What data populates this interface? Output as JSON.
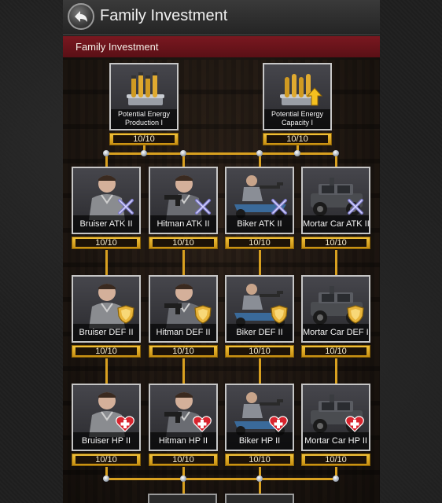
{
  "header": {
    "title": "Family Investment"
  },
  "subbar": {
    "title": "Family Investment"
  },
  "top_items": [
    {
      "label_line1": "Potential Energy",
      "label_line2": "Production I",
      "progress": "10/10"
    },
    {
      "label_line1": "Potential Energy",
      "label_line2": "Capacity I",
      "progress": "10/10"
    }
  ],
  "rows": [
    {
      "stat": "ATK",
      "badge_icon": "crossed-swords-icon",
      "cards": [
        {
          "label": "Bruiser ATK II",
          "progress": "10/10"
        },
        {
          "label": "Hitman ATK II",
          "progress": "10/10"
        },
        {
          "label": "Biker ATK II",
          "progress": "10/10"
        },
        {
          "label": "Mortar Car ATK II",
          "progress": "10/10"
        }
      ]
    },
    {
      "stat": "DEF",
      "badge_icon": "shield-icon",
      "cards": [
        {
          "label": "Bruiser DEF II",
          "progress": "10/10"
        },
        {
          "label": "Hitman DEF II",
          "progress": "10/10"
        },
        {
          "label": "Biker DEF II",
          "progress": "10/10"
        },
        {
          "label": "Mortar Car DEF II",
          "progress": "10/10"
        }
      ]
    },
    {
      "stat": "HP",
      "badge_icon": "heart-plus-icon",
      "cards": [
        {
          "label": "Bruiser HP II",
          "progress": "10/10"
        },
        {
          "label": "Hitman HP II",
          "progress": "10/10"
        },
        {
          "label": "Biker HP II",
          "progress": "10/10"
        },
        {
          "label": "Mortar Car HP II",
          "progress": "10/10"
        }
      ]
    }
  ],
  "colors": {
    "accent_gold": "#d8a020",
    "header_red": "#6b141b",
    "card_border": "#c6c6c6"
  }
}
